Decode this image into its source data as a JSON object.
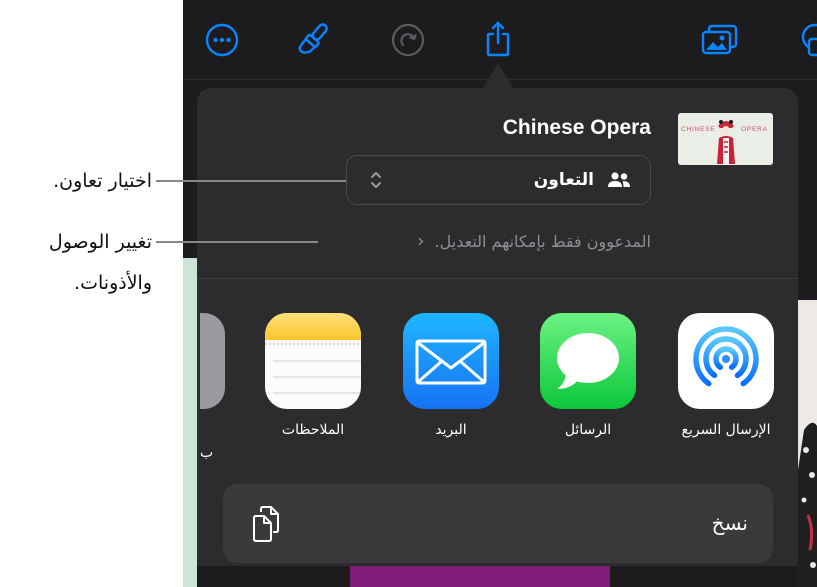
{
  "callouts": {
    "choose_collaboration": "اختيار تعاون.",
    "change_access_line1": "تغيير الوصول",
    "change_access_line2": "والأذونات."
  },
  "toolbar": {
    "icons": [
      "more-icon",
      "paintbrush-icon",
      "redo-icon",
      "share-icon",
      "media-icon",
      "shapes-icon"
    ],
    "disabled": [
      "redo-icon"
    ]
  },
  "share_sheet": {
    "document_title": "Chinese Opera",
    "thumbnail": {
      "text_left": "CHINESE",
      "text_right": "OPERA"
    },
    "collaboration_selector": {
      "selected": "التعاون",
      "icon": "people-icon",
      "chevron_icon": "chevron-up-down-icon"
    },
    "access_summary": {
      "text": "المدعوون فقط بإمكانهم التعديل.",
      "chevron": "›"
    },
    "apps": [
      {
        "label": "الإرسال السريع",
        "icon": "airdrop-icon"
      },
      {
        "label": "الرسائل",
        "icon": "messages-icon"
      },
      {
        "label": "البريد",
        "icon": "mail-icon"
      },
      {
        "label": "الملاحظات",
        "icon": "notes-icon"
      },
      {
        "label": "ب",
        "icon": "app-icon"
      }
    ],
    "copy_action": {
      "label": "نسخ",
      "icon": "copy-icon"
    }
  },
  "colors": {
    "accent": "#0a84ff",
    "toolbar_background": "#1c1c1e",
    "sheet_background": "#2c2c2e",
    "secondary_text": "#8e8e93",
    "slide_accent": "#7f1b78"
  }
}
